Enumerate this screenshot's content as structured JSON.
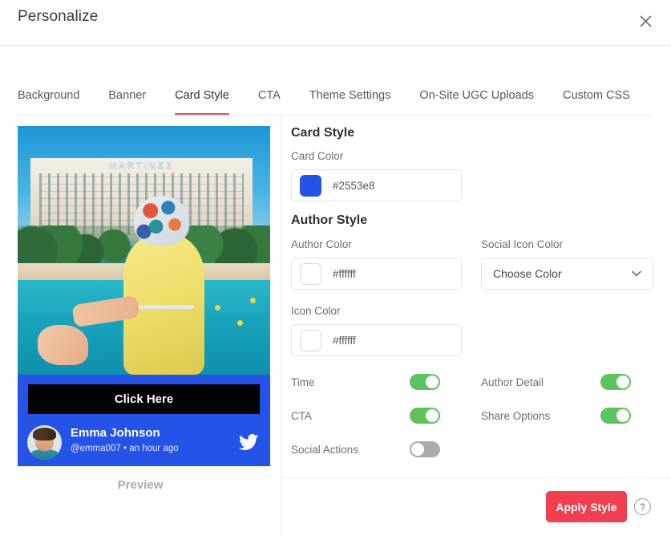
{
  "header": {
    "title": "Personalize",
    "close_icon": "close-icon"
  },
  "tabs": [
    {
      "label": "Background",
      "active": false
    },
    {
      "label": "Banner",
      "active": false
    },
    {
      "label": "Card Style",
      "active": true
    },
    {
      "label": "CTA",
      "active": false
    },
    {
      "label": "Theme Settings",
      "active": false
    },
    {
      "label": "On-Site UGC Uploads",
      "active": false
    },
    {
      "label": "Custom CSS",
      "active": false
    }
  ],
  "preview": {
    "label": "Preview",
    "cta_label": "Click Here",
    "author_name": "Emma Johnson",
    "author_meta": "@emma007  •  an hour ago",
    "social_icon": "twitter-icon",
    "photo_sign": "MARTINEZ",
    "card_bg": "#2553e8",
    "cta_bg": "#000000"
  },
  "form": {
    "card_style_title": "Card Style",
    "card_color_label": "Card Color",
    "card_color_value": "#2553e8",
    "author_style_title": "Author Style",
    "author_color_label": "Author Color",
    "author_color_value": "#ffffff",
    "social_icon_color_label": "Social Icon Color",
    "social_icon_color_value": "Choose Color",
    "icon_color_label": "Icon Color",
    "icon_color_value": "#ffffff",
    "toggles": [
      {
        "label": "Time",
        "state": "on"
      },
      {
        "label": "Author Detail",
        "state": "on"
      },
      {
        "label": "CTA",
        "state": "on"
      },
      {
        "label": "Share Options",
        "state": "on"
      },
      {
        "label": "Social Actions",
        "state": "off"
      }
    ]
  },
  "footer": {
    "apply_label": "Apply Style",
    "help_label": "?",
    "apply_color": "#ef3f51"
  }
}
